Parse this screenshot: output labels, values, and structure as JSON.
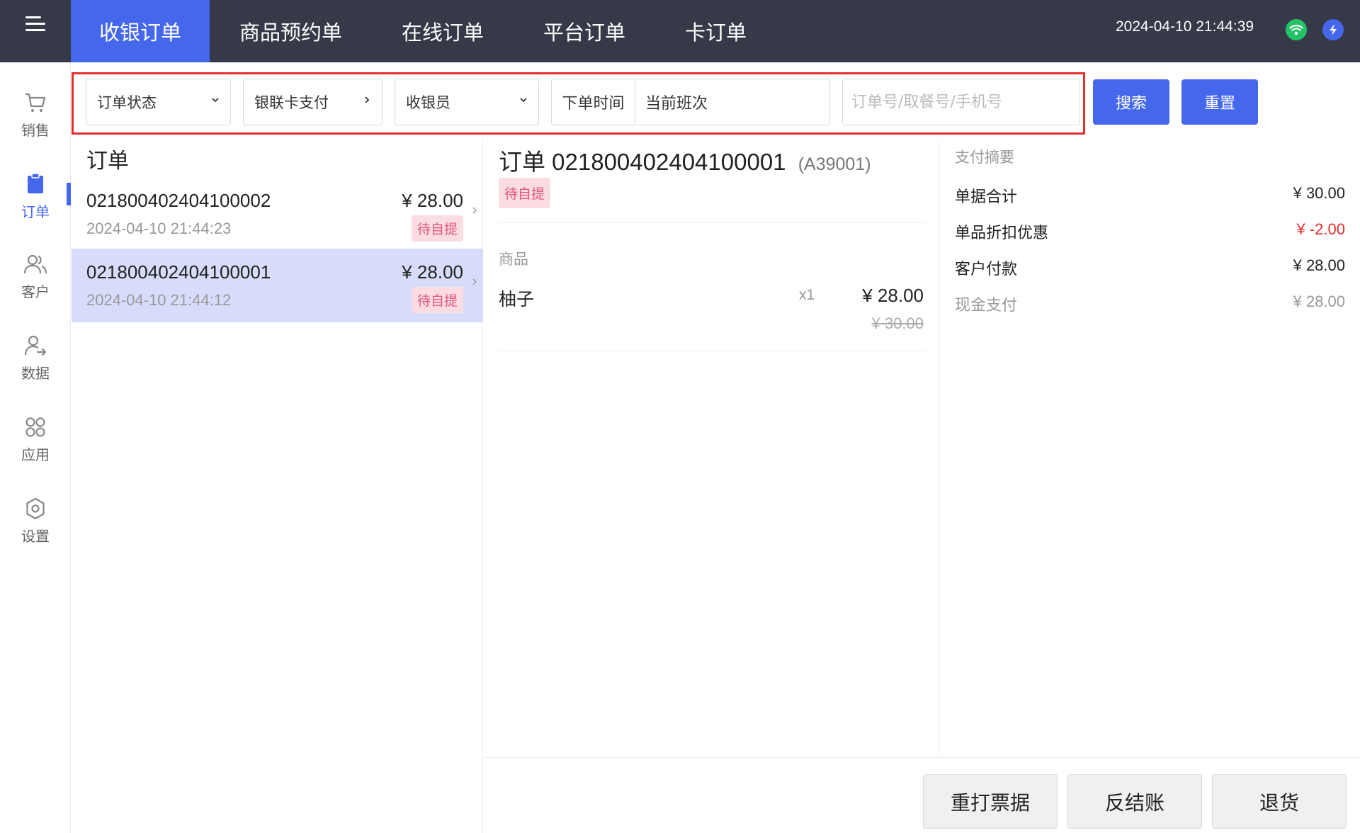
{
  "header": {
    "tabs": [
      {
        "label": "收银订单",
        "active": true
      },
      {
        "label": "商品预约单",
        "active": false
      },
      {
        "label": "在线订单",
        "active": false
      },
      {
        "label": "平台订单",
        "active": false
      },
      {
        "label": "卡订单",
        "active": false
      }
    ],
    "datetime": "2024-04-10 21:44:39",
    "icons": [
      "menu-icon",
      "wifi-icon",
      "sync-icon"
    ]
  },
  "sidebar": {
    "items": [
      {
        "label": "销售",
        "icon": "cart-icon",
        "active": false
      },
      {
        "label": "订单",
        "icon": "clipboard-icon",
        "active": true
      },
      {
        "label": "客户",
        "icon": "users-icon",
        "active": false
      },
      {
        "label": "数据",
        "icon": "user-arrow-icon",
        "active": false
      },
      {
        "label": "应用",
        "icon": "apps-icon",
        "active": false
      },
      {
        "label": "设置",
        "icon": "gear-icon",
        "active": false
      }
    ]
  },
  "filters": {
    "status": "订单状态",
    "payment": "银联卡支付",
    "cashier": "收银员",
    "time_label": "下单时间",
    "time_value": "当前班次",
    "search_placeholder": "订单号/取餐号/手机号",
    "search_button": "搜索",
    "reset_button": "重置"
  },
  "order_list": {
    "title": "订单",
    "orders": [
      {
        "number": "021800402404100002",
        "time": "2024-04-10 21:44:23",
        "amount": "¥ 28.00",
        "status": "待自提",
        "selected": false
      },
      {
        "number": "021800402404100001",
        "time": "2024-04-10 21:44:12",
        "amount": "¥ 28.00",
        "status": "待自提",
        "selected": true
      }
    ]
  },
  "detail": {
    "title_prefix": "订单",
    "number": "021800402404100001",
    "pickup_code": "(A39001)",
    "status": "待自提",
    "goods_label": "商品",
    "items": [
      {
        "name": "柚子",
        "qty": "x1",
        "price": "¥ 28.00",
        "original_price": "¥ 30.00"
      }
    ]
  },
  "summary": {
    "title": "支付摘要",
    "rows": [
      {
        "label": "单据合计",
        "value": "¥ 30.00"
      },
      {
        "label": "单品折扣优惠",
        "value": "¥ -2.00"
      },
      {
        "label": "客户付款",
        "value": "¥ 28.00"
      },
      {
        "label": "现金支付",
        "value": "¥ 28.00"
      }
    ]
  },
  "actions": {
    "reprint": "重打票据",
    "reverse": "反结账",
    "refund": "退货"
  },
  "colors": {
    "topbar": "#363a48",
    "accent": "#4467ec",
    "badge_bg": "#fbdce3",
    "badge_text": "#e05a7d",
    "negative": "#e62d2d",
    "highlight_frame": "#e62d2d",
    "selected_row": "#d6dcfa"
  }
}
